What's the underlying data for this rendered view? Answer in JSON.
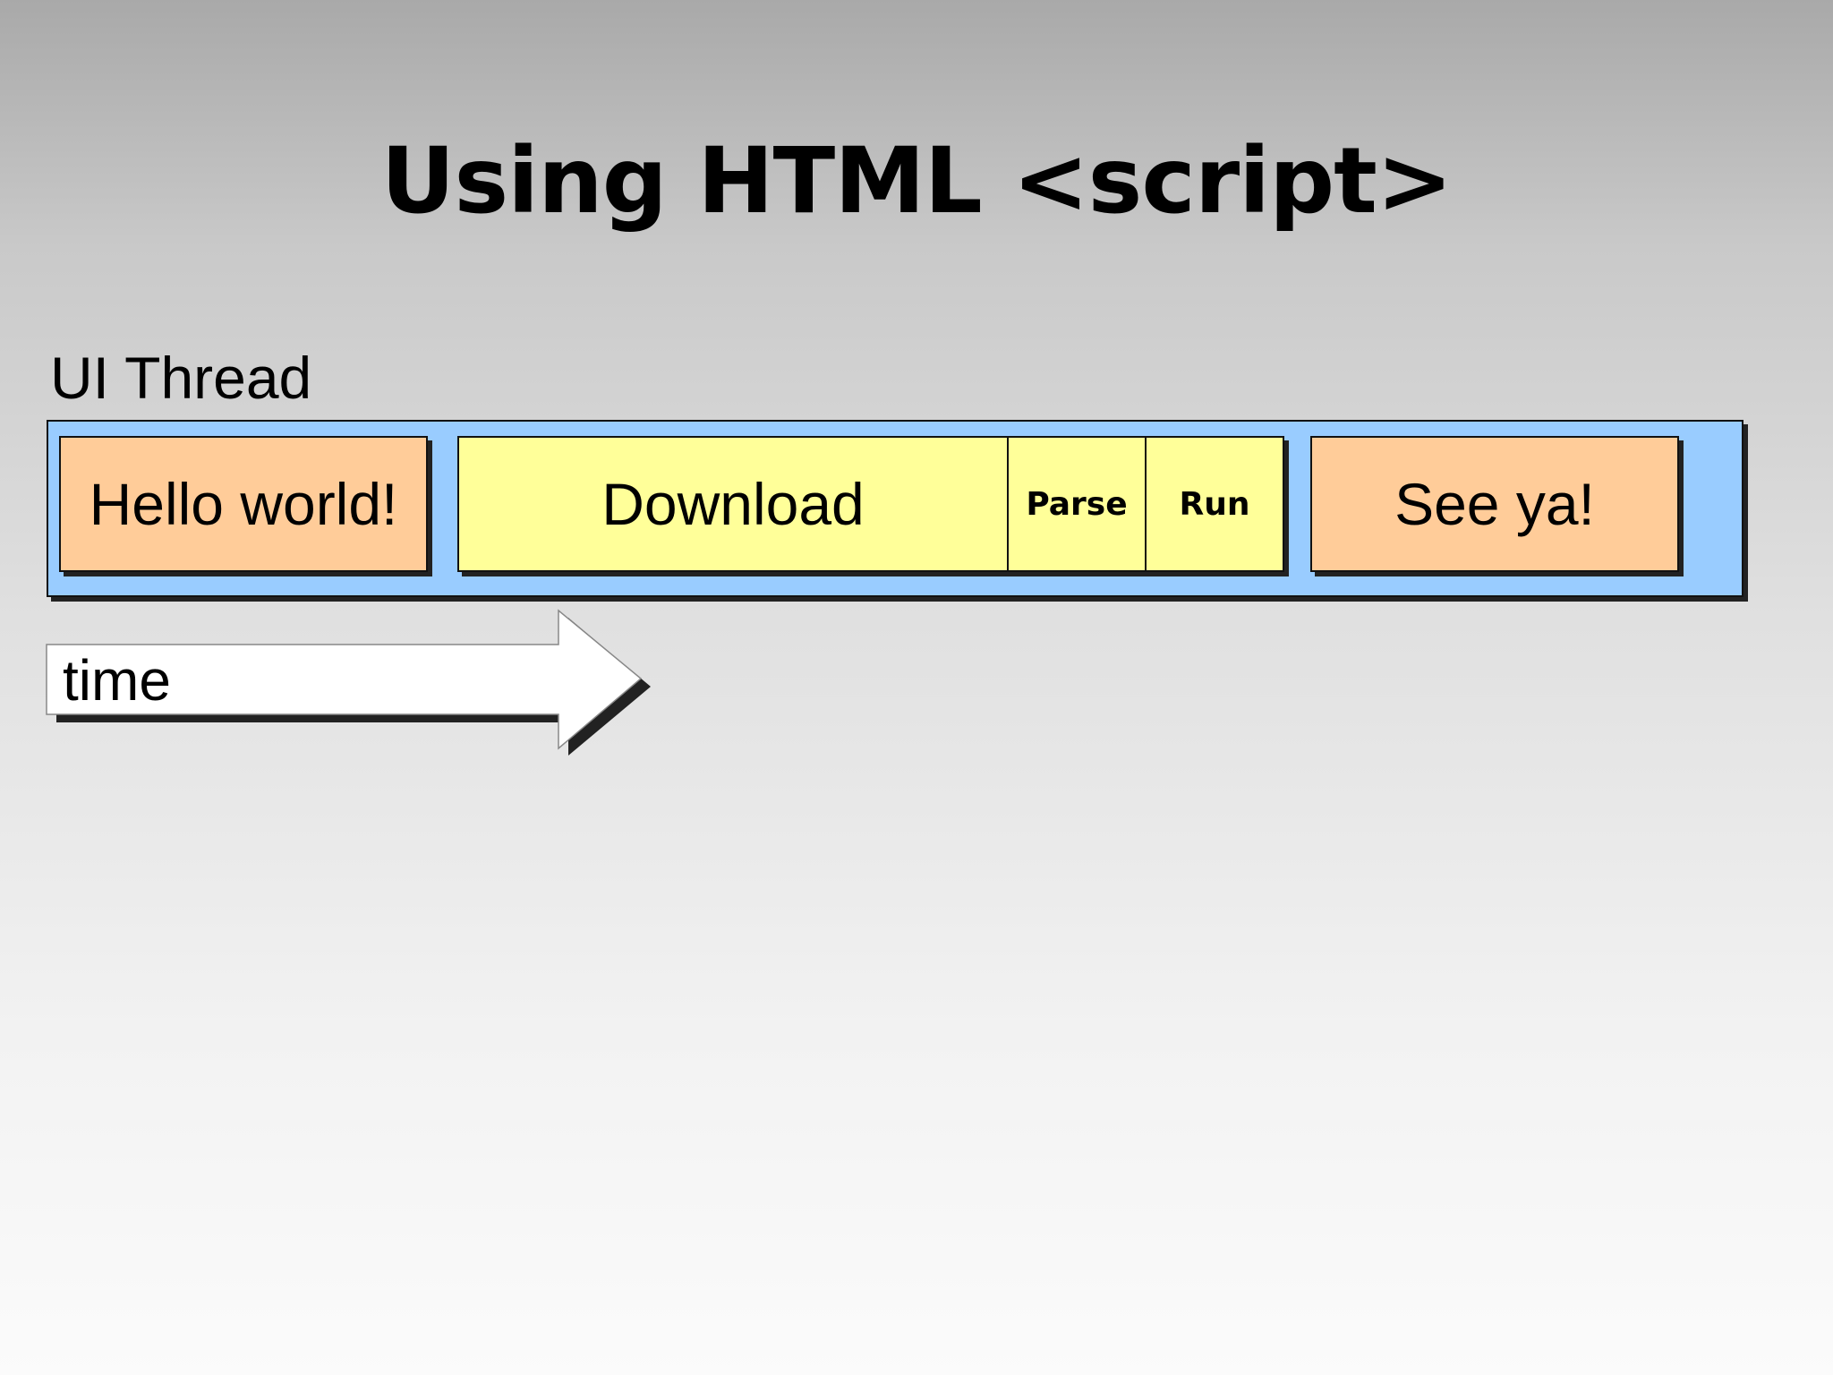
{
  "slide": {
    "title": "Using HTML <script>"
  },
  "diagram": {
    "thread_label": "UI Thread",
    "blocks": [
      {
        "label": "Hello world!",
        "color": "#ffcc99"
      },
      {
        "label": "Download",
        "color": "#ffff99"
      },
      {
        "label": "Parse",
        "color": "#ffff99"
      },
      {
        "label": "Run",
        "color": "#ffff99"
      },
      {
        "label": "See ya!",
        "color": "#ffcc99"
      }
    ],
    "thread_color": "#99ccff",
    "time_label": "time"
  }
}
